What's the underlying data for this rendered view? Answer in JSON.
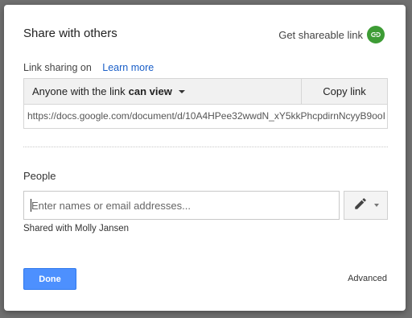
{
  "dialog": {
    "title": "Share with others",
    "get_link_label": "Get shareable link",
    "link_icon": "link-icon",
    "accent_color": "#3d9c35"
  },
  "link_sharing": {
    "label": "Link sharing on",
    "learn_more": "Learn more",
    "access_prefix": "Anyone with the link",
    "access_level": "can view",
    "copy_label": "Copy link",
    "url": "https://docs.google.com/document/d/10A4HPee32wwdN_xY5kkPhcpdirnNcyyB9ooI"
  },
  "people": {
    "label": "People",
    "placeholder": "Enter names or email addresses...",
    "permission_icon": "pencil-icon",
    "shared_with": "Shared with Molly Jansen"
  },
  "footer": {
    "done_label": "Done",
    "advanced_label": "Advanced",
    "primary_color": "#4d90fe"
  }
}
